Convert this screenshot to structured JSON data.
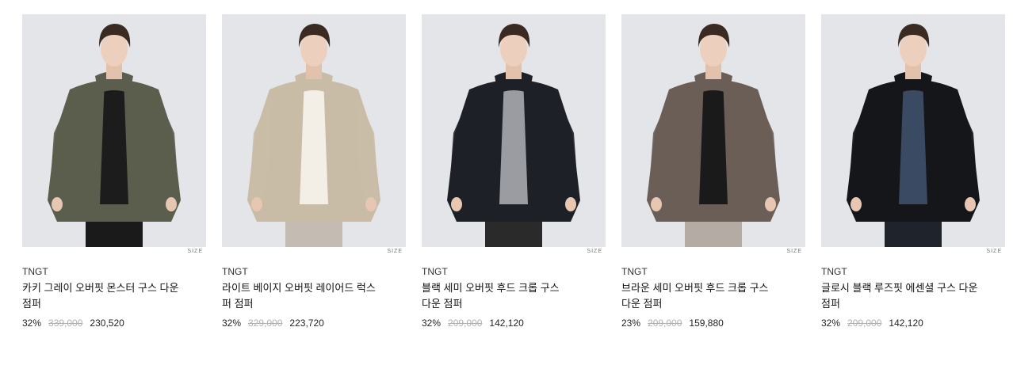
{
  "products": [
    {
      "brand": "TNGT",
      "name": "카키 그레이 오버핏 몬스터 구스 다운 점퍼",
      "discount": "32%",
      "original_price": "339,000",
      "sale_price": "230,520",
      "size_label": "SIZE",
      "jacket_color": "#5b5e4c",
      "inner_color": "#1c1c1c",
      "pants_color": "#1a1a1a",
      "image_icon": "model-photo-khaki-parka"
    },
    {
      "brand": "TNGT",
      "name": "라이트 베이지 오버핏 레이어드 럭스 퍼 점퍼",
      "discount": "32%",
      "original_price": "329,000",
      "sale_price": "223,720",
      "size_label": "SIZE",
      "jacket_color": "#c9bca7",
      "inner_color": "#f3efe6",
      "pants_color": "#c4bcb2",
      "image_icon": "model-photo-beige-fur-jacket"
    },
    {
      "brand": "TNGT",
      "name": "블랙 세미 오버핏 후드 크롭 구스 다운 점퍼",
      "discount": "32%",
      "original_price": "209,000",
      "sale_price": "142,120",
      "size_label": "SIZE",
      "jacket_color": "#1e2028",
      "inner_color": "#9a9ca1",
      "pants_color": "#2a2a2a",
      "image_icon": "model-photo-black-hood-puffer"
    },
    {
      "brand": "TNGT",
      "name": "브라운 세미 오버핏 후드 크롭 구스 다운 점퍼",
      "discount": "23%",
      "original_price": "209,000",
      "sale_price": "159,880",
      "size_label": "SIZE",
      "jacket_color": "#6a5e56",
      "inner_color": "#1a1a1a",
      "pants_color": "#b3aba4",
      "image_icon": "model-photo-brown-hood-puffer"
    },
    {
      "brand": "TNGT",
      "name": "글로시 블랙 루즈핏 에센셜 구스 다운 점퍼",
      "discount": "32%",
      "original_price": "209,000",
      "sale_price": "142,120",
      "size_label": "SIZE",
      "jacket_color": "#15161a",
      "inner_color": "#3a4a62",
      "pants_color": "#1f242c",
      "image_icon": "model-photo-glossy-black-puffer"
    }
  ]
}
